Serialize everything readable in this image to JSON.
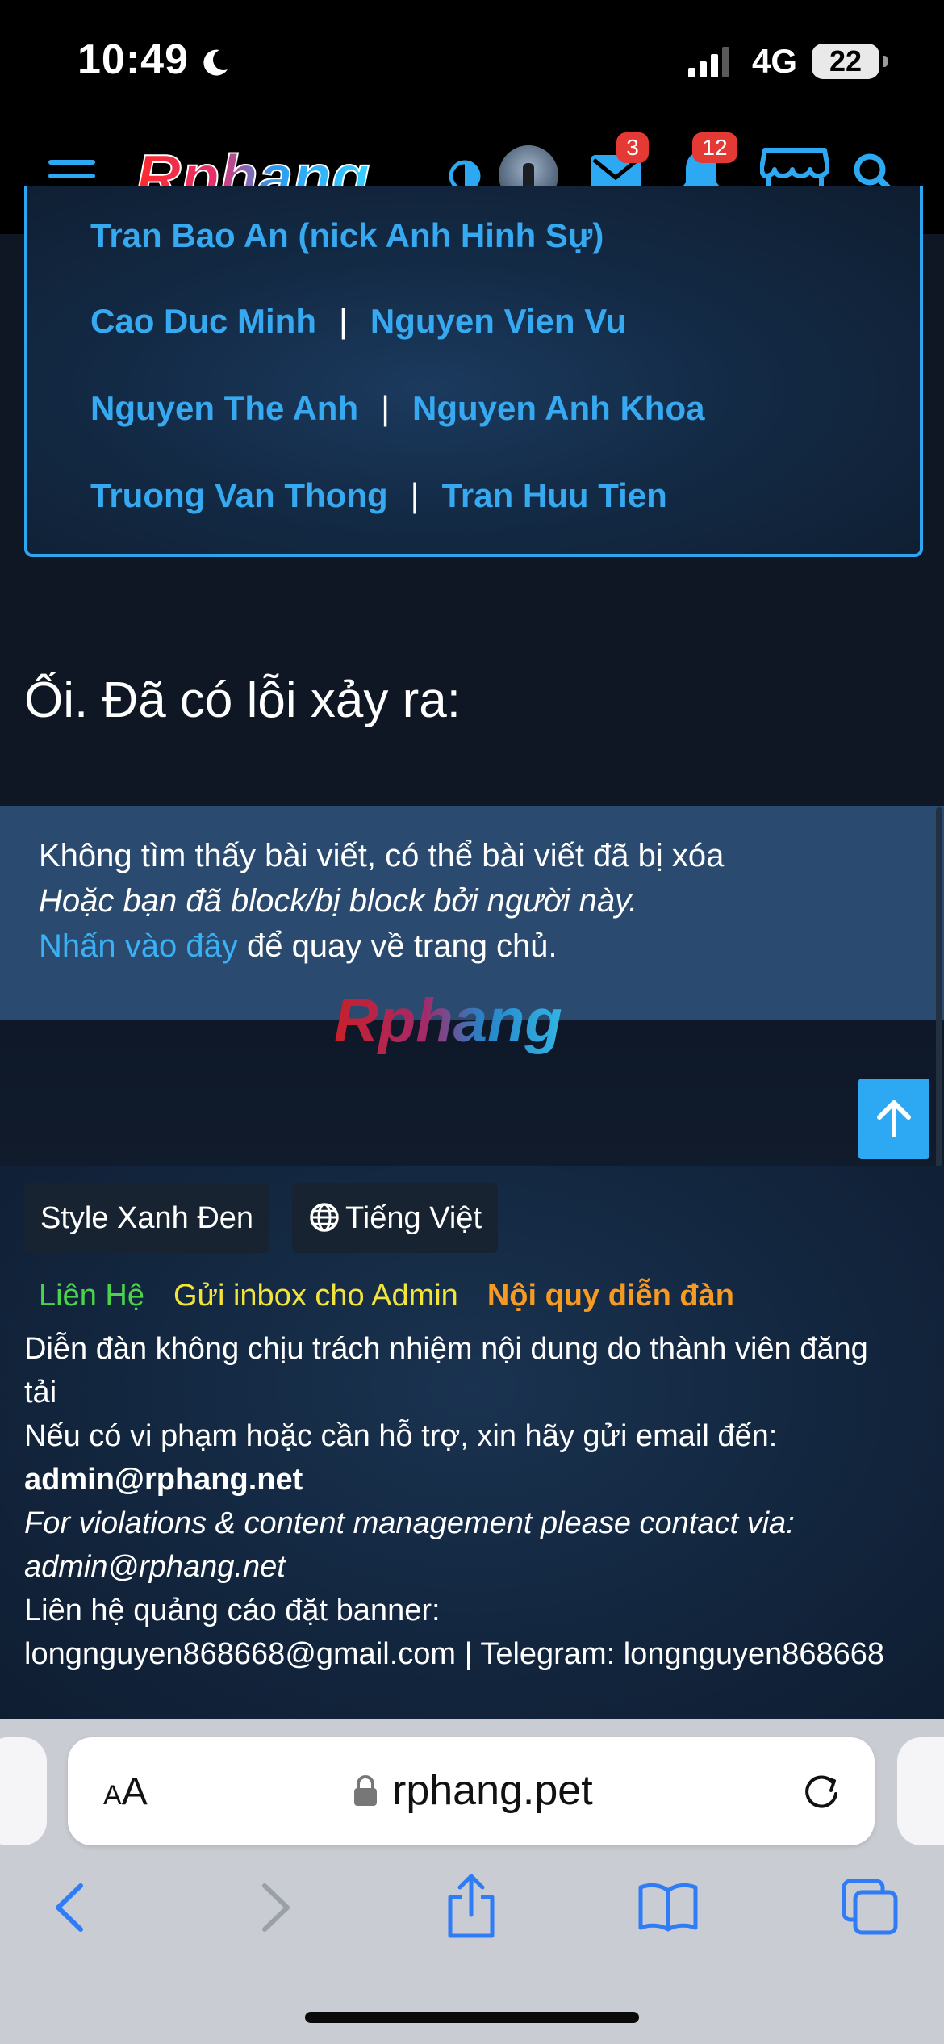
{
  "status_bar": {
    "time": "10:49",
    "network": "4G",
    "battery": "22"
  },
  "header": {
    "logo_text": "Rphang",
    "messages_badge": "3",
    "alerts_badge": "12"
  },
  "names": {
    "rows": [
      [
        "Tran Bao An (nick Anh Hinh Sự)"
      ],
      [
        "Cao Duc Minh",
        "Nguyen Vien Vu"
      ],
      [
        "Nguyen The Anh",
        "Nguyen Anh Khoa"
      ],
      [
        "Truong Van Thong",
        "Tran Huu Tien"
      ]
    ],
    "separator": "|"
  },
  "error": {
    "title": "Ối. Đã có lỗi xảy ra:",
    "line1": "Không tìm thấy bài viết, có thể bài viết đã bị xóa",
    "line2": "Hoặc bạn đã block/bị block bởi người này.",
    "link_text": "Nhấn vào đây",
    "line3_rest": " để quay về trang chủ."
  },
  "footer": {
    "style_button": "Style Xanh Đen",
    "language_button": "Tiếng Việt",
    "links": [
      {
        "label": "Liên Hệ",
        "color": "#4cd34c"
      },
      {
        "label": "Gửi inbox cho Admin",
        "color": "#f2e43a"
      },
      {
        "label": "Nội quy diễn đàn",
        "color": "#f59a23"
      }
    ],
    "disclaimer_1": "Diễn đàn không chịu trách nhiệm nội dung do thành viên đăng",
    "disclaimer_2": "tải",
    "support_line": "Nếu có vi phạm hoặc cần hỗ trợ, xin hãy gửi email đến:",
    "admin_email": "admin@rphang.net",
    "violations_en": "For violations & content management please contact via:",
    "admin_email_en": "admin@rphang.net",
    "ads_label": "Liên hệ quảng cáo đặt banner:",
    "ads_contact": "longnguyen868668@gmail.com | Telegram: longnguyen868668"
  },
  "browser": {
    "aa_small": "A",
    "aa_large": "A",
    "domain": "rphang.pet"
  },
  "colors": {
    "accent": "#2da8f2",
    "link": "#36a9f0",
    "badge": "#e53935"
  }
}
